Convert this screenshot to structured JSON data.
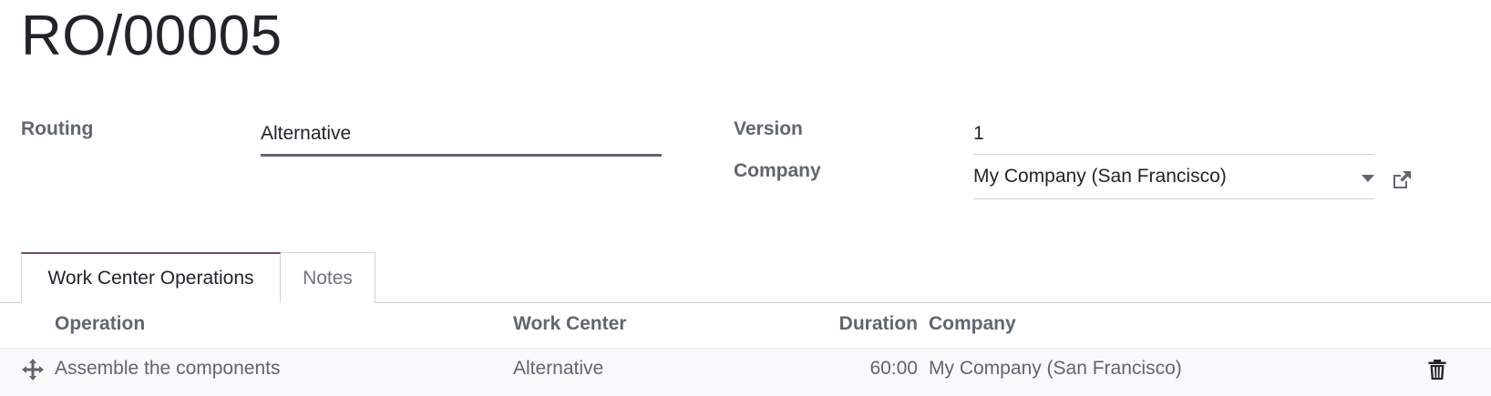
{
  "record": {
    "title": "RO/00005"
  },
  "form": {
    "routing_label": "Routing",
    "routing_value": "Alternative",
    "version_label": "Version",
    "version_value": "1",
    "company_label": "Company",
    "company_value": "My Company (San Francisco)"
  },
  "tabs": [
    {
      "label": "Work Center Operations",
      "active": true
    },
    {
      "label": "Notes",
      "active": false
    }
  ],
  "table": {
    "headers": [
      "Operation",
      "Work Center",
      "Duration",
      "Company"
    ],
    "rows": [
      {
        "operation": "Assemble the components",
        "work_center": "Alternative",
        "duration": "60:00",
        "company": "My Company (San Francisco)"
      }
    ]
  },
  "icons": {
    "external_link": "external-link-icon",
    "drag_handle": "move-icon",
    "delete": "trash-icon",
    "dropdown": "caret-down-icon"
  },
  "colors": {
    "accent": "#714b67",
    "label": "#5f6670",
    "text": "#212529"
  }
}
